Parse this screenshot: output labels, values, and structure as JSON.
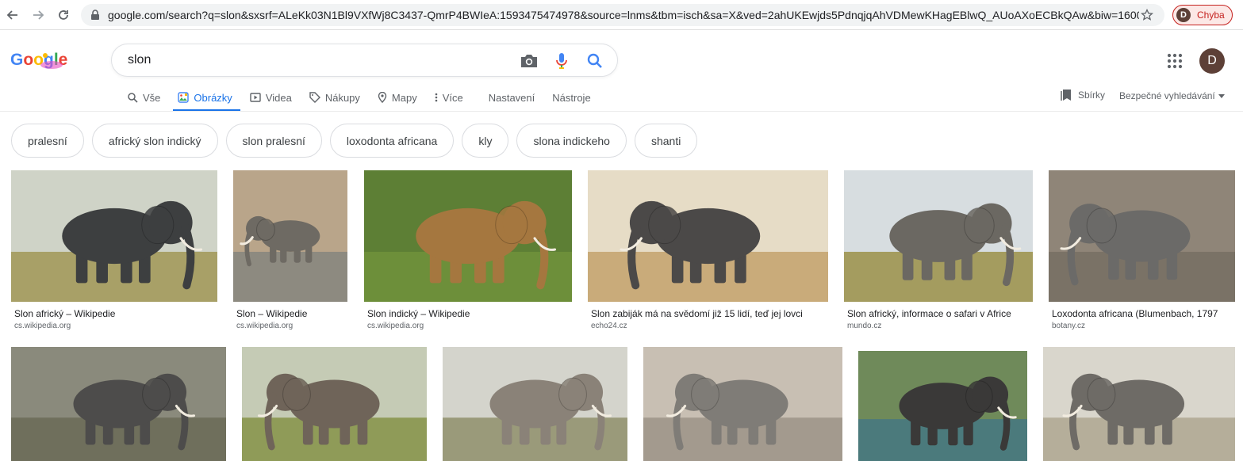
{
  "browser": {
    "url": "google.com/search?q=slon&sxsrf=ALeKk03N1Bl9VXfWj8C3437-QmrP4BWIeA:1593475474978&source=lnms&tbm=isch&sa=X&ved=2ahUKEwjds5PdnqjqAhVDMewKHagEBlwQ_AUoAXoECBkQAw&biw=1600...",
    "profile_initial": "D",
    "profile_label": "Chyba"
  },
  "search": {
    "query": "slon"
  },
  "tabs": [
    {
      "label": "Vše",
      "icon": "search-icon"
    },
    {
      "label": "Obrázky",
      "icon": "image-icon",
      "active": true
    },
    {
      "label": "Videa",
      "icon": "video-icon"
    },
    {
      "label": "Nákupy",
      "icon": "tag-icon"
    },
    {
      "label": "Mapy",
      "icon": "map-pin-icon"
    },
    {
      "label": "Více",
      "icon": "more-vert-icon"
    },
    {
      "label": "Nastavení"
    },
    {
      "label": "Nástroje"
    }
  ],
  "header_right": {
    "collections": "Sbírky",
    "safe_search": "Bezpečné vyhledávání",
    "avatar_initial": "D"
  },
  "chips": [
    "pralesní",
    "africký slon indický",
    "slon pralesní",
    "loxodonta africana",
    "kly",
    "slona indickeho",
    "shanti"
  ],
  "results_row1": [
    {
      "title": "Slon africký – Wikipedie",
      "source": "cs.wikipedia.org",
      "sky": "#cfd3c7",
      "ground": "#a8a067",
      "body": "#3d3f40"
    },
    {
      "title": "Slon – Wikipedie",
      "source": "cs.wikipedia.org",
      "sky": "#b9a58a",
      "ground": "#8d8a80",
      "body": "#6e6a63"
    },
    {
      "title": "Slon indický – Wikipedie",
      "source": "cs.wikipedia.org",
      "sky": "#5d7f35",
      "ground": "#6d8f3a",
      "body": "#a5773f"
    },
    {
      "title": "Slon zabiják má na svědomí již 15 lidí, teď jej lovci",
      "source": "echo24.cz",
      "sky": "#e6dcc6",
      "ground": "#c9ab7a",
      "body": "#4b4948"
    },
    {
      "title": "Slon africký, informace o safari v Africe",
      "source": "mundo.cz",
      "sky": "#d7dde0",
      "ground": "#a49c5f",
      "body": "#6b6862"
    },
    {
      "title": "Loxodonta africana (Blumenbach, 1797",
      "source": "botany.cz",
      "sky": "#8f8578",
      "ground": "#7a7266",
      "body": "#6b6a68"
    }
  ],
  "results_row2": [
    {
      "sky": "#8a8a7c",
      "ground": "#6f6f5c",
      "body": "#4d4c4b"
    },
    {
      "sky": "#c5cbb5",
      "ground": "#8f9b58",
      "body": "#6f6459"
    },
    {
      "sky": "#d4d4cc",
      "ground": "#9a9a7a",
      "body": "#8a8278"
    },
    {
      "sky": "#c8bfb3",
      "ground": "#a39a8e",
      "body": "#7f7c77"
    },
    {
      "sky": "#6f8a5a",
      "ground": "#4b7a7c",
      "body": "#3a3938"
    },
    {
      "sky": "#d9d6cc",
      "ground": "#b5ae9a",
      "body": "#6e6b66"
    }
  ]
}
